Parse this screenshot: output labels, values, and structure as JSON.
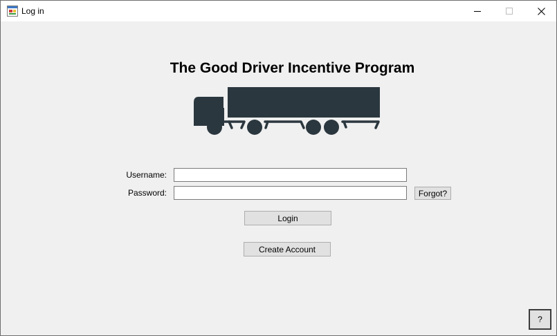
{
  "window": {
    "title": "Log in",
    "controls": [
      "minimize-icon",
      "maximize-icon",
      "close-icon"
    ]
  },
  "main": {
    "heading": "The Good Driver Incentive Program",
    "logo_icon": "truck-icon"
  },
  "form": {
    "username_label": "Username:",
    "username_value": "",
    "password_label": "Password:",
    "password_value": "",
    "forgot_label": "Forgot?",
    "login_label": "Login",
    "create_account_label": "Create Account"
  },
  "help": {
    "label": "?"
  },
  "colors": {
    "truck": "#2b373e",
    "background": "#f0f0f0",
    "button": "#e1e1e1"
  }
}
